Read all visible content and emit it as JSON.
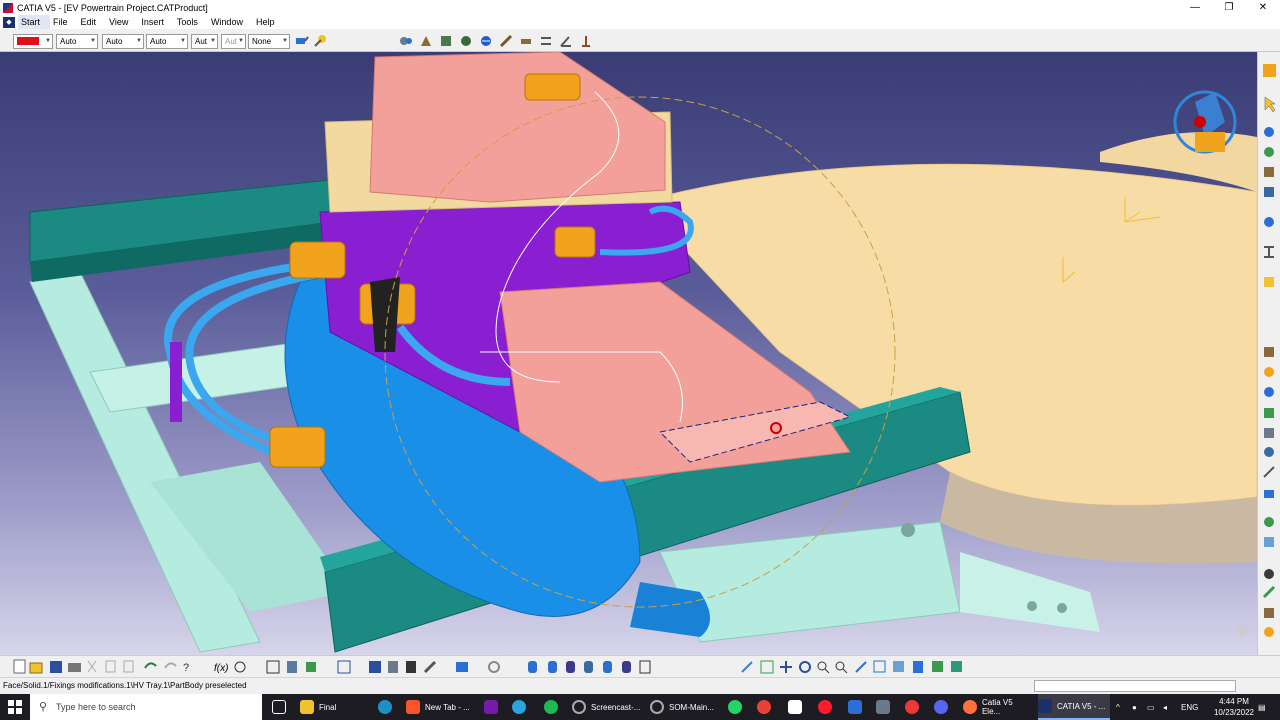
{
  "window": {
    "title": "CATIA V5 - [EV Powertrain Project.CATProduct]",
    "min": "—",
    "max": "❐",
    "close": "✕"
  },
  "menu": {
    "start": "Start",
    "file": "File",
    "edit": "Edit",
    "view": "View",
    "insert": "Insert",
    "tools": "Tools",
    "window": "Window",
    "help": "Help"
  },
  "props": {
    "line_type": "Auto",
    "thickness": "Auto",
    "weight": "Auto",
    "layer": "Aut",
    "point": "Aut",
    "style": "None",
    "color": "#e0101a"
  },
  "status": {
    "text": "Face/Solid.1/Fixings modifications.1\\HV Tray.1\\PartBody preselected"
  },
  "taskbar": {
    "search": "Type here to search",
    "apps": [
      {
        "label": "Final",
        "color": "#f2c12e"
      },
      {
        "label": "New Tab - ...",
        "color": "#fb542b"
      },
      {
        "label": "Screencast-...",
        "color": "#888"
      },
      {
        "label": "SOM-Main...",
        "color": "#999"
      },
      {
        "label": "Catia V5 Ele...",
        "color": "#ff7139"
      },
      {
        "label": "CATIA V5 - ...",
        "color": "#1b2f6b"
      }
    ],
    "lang": "ENG",
    "time": "4:44 PM",
    "date": "10/23/2022"
  },
  "colors": {
    "battery_pink": "#f4a09a",
    "tan": "#f2d9a0",
    "purple": "#8a1fd1",
    "teal": "#1a8a82",
    "mint": "#b6ece0",
    "cable": "#3aa7ee",
    "connector": "#f2a31e",
    "motor": "#1a8fe8",
    "floor": "#f7dca6"
  }
}
